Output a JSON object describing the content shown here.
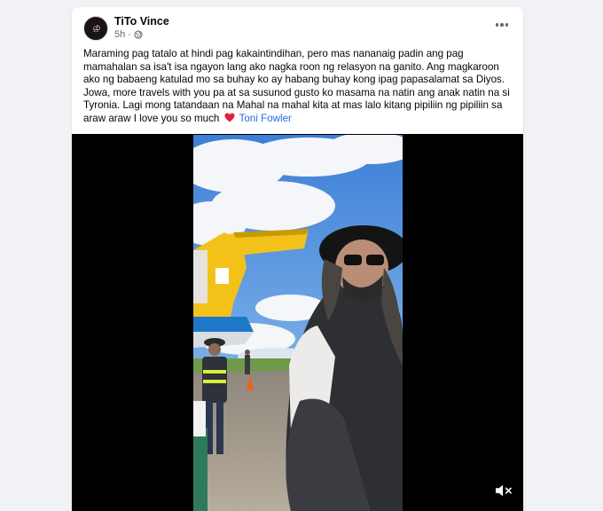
{
  "post": {
    "author": "TiTo Vince",
    "time": "5h",
    "privacy_icon": "globe-icon",
    "text": "Maraming pag tatalo at hindi pag kakaintindihan, pero mas nananaig padin ang pag mamahalan sa isa't isa ngayon lang ako nagka roon ng relasyon na ganito. Ang magkaroon ako ng babaeng katulad mo sa buhay ko ay habang buhay kong ipag papasalamat sa Diyos. Jowa, more travels with you pa at sa susunod gusto ko masama na natin ang anak natin na si Tyronia. Lagi mong tatandaan na Mahal na mahal kita at mas lalo kitang pipiliin ng pipiliin sa araw araw I love you so much",
    "heart_icon": "red-heart-emoji",
    "mention": "Toni Fowler",
    "more_icon": "ellipsis-icon"
  },
  "video": {
    "mute_icon": "speaker-muted-icon"
  },
  "colors": {
    "background": "#f0f2f5",
    "card": "#ffffff",
    "mention": "#216fdb",
    "meta": "#65676b",
    "heart": "#e41e3f"
  }
}
